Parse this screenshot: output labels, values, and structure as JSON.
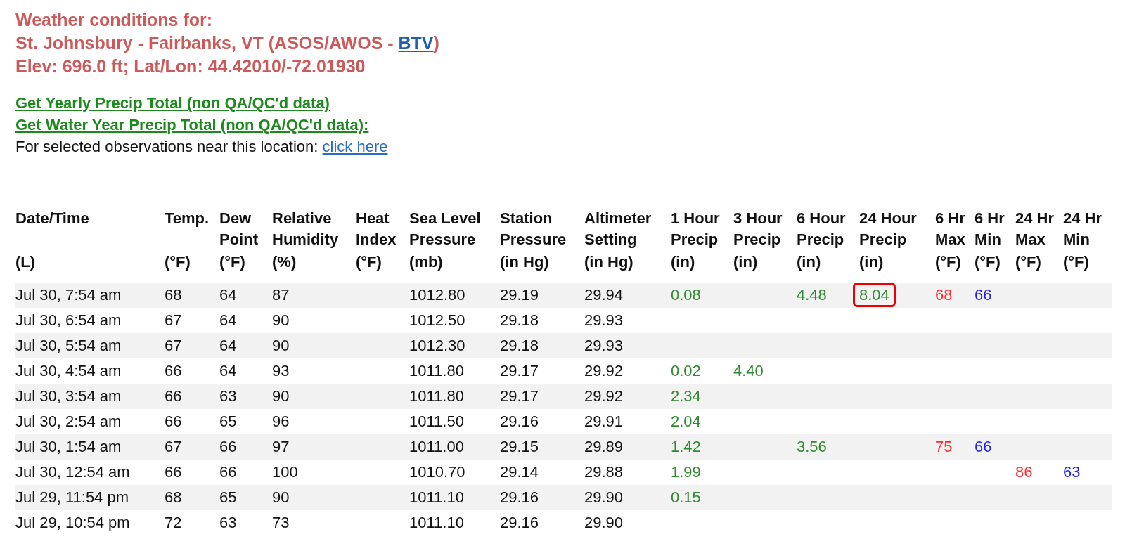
{
  "heading": {
    "lines": [
      "Weather conditions for:",
      "St. Johnsbury - Fairbanks, VT (ASOS/AWOS - ",
      "Elev: 696.0 ft; Lat/Lon: 44.42010/-72.01930"
    ],
    "network_link": "BTV",
    "network_suffix": ")"
  },
  "links": [
    {
      "label": "Get Yearly Precip Total (non QA/QC'd data)"
    },
    {
      "label": "Get Water Year Precip Total (non QA/QC'd data):"
    }
  ],
  "nearby": {
    "text": "For selected observations near this location: ",
    "link": "click here"
  },
  "table": {
    "columns": [
      {
        "title": [
          "Date/Time"
        ],
        "unit": "(L)",
        "kind": "time"
      },
      {
        "title": [
          "Temp."
        ],
        "unit": "(°F)",
        "kind": "plain"
      },
      {
        "title": [
          "Dew",
          "Point"
        ],
        "unit": "(°F)",
        "kind": "plain"
      },
      {
        "title": [
          "Relative",
          "Humidity"
        ],
        "unit": "(%)",
        "kind": "plain"
      },
      {
        "title": [
          "Heat",
          "Index"
        ],
        "unit": "(°F)",
        "kind": "plain"
      },
      {
        "title": [
          "Sea Level",
          "Pressure"
        ],
        "unit": "(mb)",
        "kind": "plain"
      },
      {
        "title": [
          "Station",
          "Pressure"
        ],
        "unit": "(in Hg)",
        "kind": "plain"
      },
      {
        "title": [
          "Altimeter",
          "Setting"
        ],
        "unit": "(in Hg)",
        "kind": "plain"
      },
      {
        "title": [
          "1 Hour",
          "Precip"
        ],
        "unit": "(in)",
        "kind": "precip"
      },
      {
        "title": [
          "3 Hour",
          "Precip"
        ],
        "unit": "(in)",
        "kind": "precip"
      },
      {
        "title": [
          "6 Hour",
          "Precip"
        ],
        "unit": "(in)",
        "kind": "precip"
      },
      {
        "title": [
          "24 Hour",
          "Precip"
        ],
        "unit": "(in)",
        "kind": "precip"
      },
      {
        "title": [
          "6 Hr",
          "Max"
        ],
        "unit": "(°F)",
        "kind": "max"
      },
      {
        "title": [
          "6 Hr",
          "Min"
        ],
        "unit": "(°F)",
        "kind": "min"
      },
      {
        "title": [
          "24 Hr",
          "Max"
        ],
        "unit": "(°F)",
        "kind": "max"
      },
      {
        "title": [
          "24 Hr",
          "Min"
        ],
        "unit": "(°F)",
        "kind": "min"
      }
    ],
    "rows": [
      {
        "cells": [
          "Jul 30, 7:54 am",
          "68",
          "64",
          "87",
          null,
          "1012.80",
          "29.19",
          "29.94",
          "0.08",
          null,
          "4.48",
          {
            "text": "8.04",
            "circled": true
          },
          "68",
          "66",
          null,
          null
        ]
      },
      {
        "cells": [
          "Jul 30, 6:54 am",
          "67",
          "64",
          "90",
          null,
          "1012.50",
          "29.18",
          "29.93",
          null,
          null,
          null,
          null,
          null,
          null,
          null,
          null
        ]
      },
      {
        "cells": [
          "Jul 30, 5:54 am",
          "67",
          "64",
          "90",
          null,
          "1012.30",
          "29.18",
          "29.93",
          null,
          null,
          null,
          null,
          null,
          null,
          null,
          null
        ]
      },
      {
        "cells": [
          "Jul 30, 4:54 am",
          "66",
          "64",
          "93",
          null,
          "1011.80",
          "29.17",
          "29.92",
          "0.02",
          "4.40",
          null,
          null,
          null,
          null,
          null,
          null
        ]
      },
      {
        "cells": [
          "Jul 30, 3:54 am",
          "66",
          "63",
          "90",
          null,
          "1011.80",
          "29.17",
          "29.92",
          "2.34",
          null,
          null,
          null,
          null,
          null,
          null,
          null
        ]
      },
      {
        "cells": [
          "Jul 30, 2:54 am",
          "66",
          "65",
          "96",
          null,
          "1011.50",
          "29.16",
          "29.91",
          "2.04",
          null,
          null,
          null,
          null,
          null,
          null,
          null
        ]
      },
      {
        "cells": [
          "Jul 30, 1:54 am",
          "67",
          "66",
          "97",
          null,
          "1011.00",
          "29.15",
          "29.89",
          "1.42",
          null,
          "3.56",
          null,
          "75",
          "66",
          null,
          null
        ]
      },
      {
        "cells": [
          "Jul 30, 12:54 am",
          "66",
          "66",
          "100",
          null,
          "1010.70",
          "29.14",
          "29.88",
          "1.99",
          null,
          null,
          null,
          null,
          null,
          "86",
          "63"
        ]
      },
      {
        "cells": [
          "Jul 29, 11:54 pm",
          "68",
          "65",
          "90",
          null,
          "1011.10",
          "29.16",
          "29.90",
          "0.15",
          null,
          null,
          null,
          null,
          null,
          null,
          null
        ]
      },
      {
        "cells": [
          "Jul 29, 10:54 pm",
          "72",
          "63",
          "73",
          null,
          "1011.10",
          "29.16",
          "29.90",
          null,
          null,
          null,
          null,
          null,
          null,
          null,
          null
        ]
      }
    ]
  }
}
